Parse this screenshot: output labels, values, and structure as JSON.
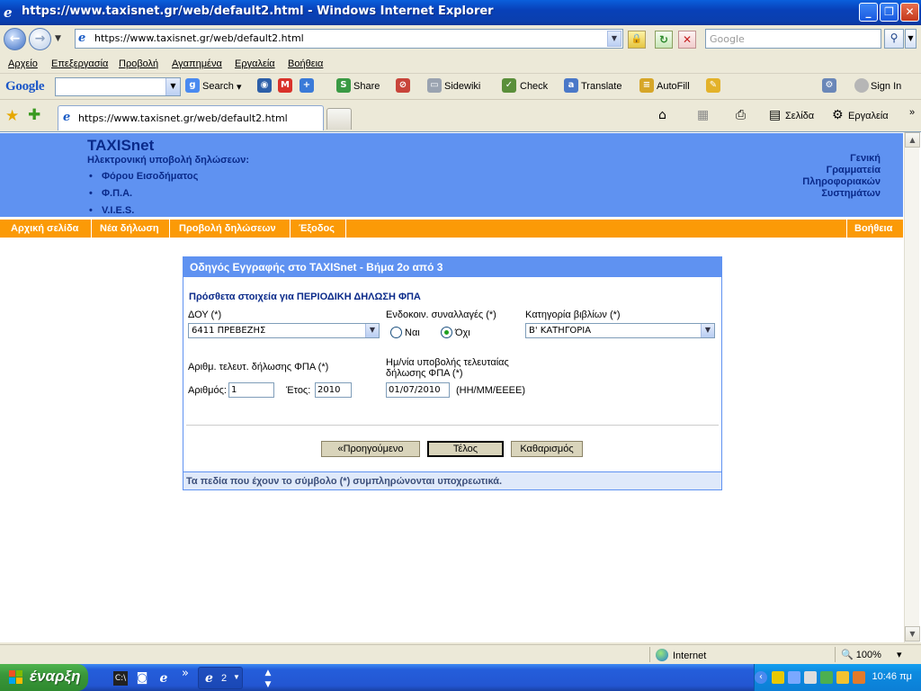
{
  "window": {
    "title": "https://www.taxisnet.gr/web/default2.html - Windows Internet Explorer",
    "minimize": "_",
    "maximize": "❐",
    "close": "✕"
  },
  "address_bar": {
    "url": "https://www.taxisnet.gr/web/default2.html",
    "search_placeholder": "Google"
  },
  "menu": {
    "items": [
      "Αρχείο",
      "Επεξεργασία",
      "Προβολή",
      "Αγαπημένα",
      "Εργαλεία",
      "Βοήθεια"
    ]
  },
  "google_toolbar": {
    "logo": "Google",
    "search_label": "Search",
    "share_label": "Share",
    "sidewiki_label": "Sidewiki",
    "check_label": "Check",
    "translate_label": "Translate",
    "autofill_label": "AutoFill",
    "signin_label": "Sign In"
  },
  "tabs": {
    "active_tab_title": "https://www.taxisnet.gr/web/default2.html"
  },
  "command_bar": {
    "page_label": "Σελίδα",
    "tools_label": "Εργαλεία",
    "more": "»"
  },
  "banner": {
    "brand": "TAXISnet",
    "subtitle": "Ηλεκτρονική υποβολή δηλώσεων:",
    "bullets": [
      "Φόρου Εισοδήματος",
      "Φ.Π.Α.",
      "V.I.E.S."
    ],
    "right_lines": [
      "Γενική",
      "Γραμματεία",
      "Πληροφοριακών",
      "Συστημάτων"
    ]
  },
  "nav": {
    "home": "Αρχική σελίδα",
    "new_declaration": "Νέα δήλωση",
    "view_declarations": "Προβολή δηλώσεων",
    "exit": "Έξοδος",
    "help": "Βοήθεια"
  },
  "wizard": {
    "title": "Οδηγός Εγγραφής στο TAXISnet - Βήμα 2ο από 3",
    "section_title": "Πρόσθετα στοιχεία για ΠΕΡΙΟΔΙΚΗ ΔΗΛΩΣΗ ΦΠΑ",
    "doy_label": "ΔΟΥ (*)",
    "doy_value": "6411 ΠΡΕΒΕΖΗΣ",
    "intra_label": "Ενδοκοιν. συναλλαγές (*)",
    "yes_label": "Ναι",
    "no_label": "Όχι",
    "intra_selected": "Όχι",
    "books_label": "Κατηγορία βιβλίων (*)",
    "books_value": "Β' ΚΑΤΗΓΟΡΙΑ",
    "last_decl_label": "Αριθμ. τελευτ. δήλωσης ΦΠΑ (*)",
    "number_label": "Αριθμός:",
    "number_value": "1",
    "year_label": "Έτος:",
    "year_value": "2010",
    "date_label_line1": "Ημ/νία υποβολής τελευταίας",
    "date_label_line2": "δήλωσης ΦΠΑ (*)",
    "date_value": "01/07/2010",
    "date_format": "(ΗΗ/ΜΜ/ΕΕΕΕ)",
    "prev_button": "«Προηγούμενο",
    "finish_button": "Τέλος",
    "clear_button": "Καθαρισμός",
    "footer_note": "Τα πεδία που έχουν το σύμβολο (*) συμπληρώνονται υποχρεωτικά."
  },
  "status_bar": {
    "zone": "Internet",
    "zoom": "100%"
  },
  "taskbar": {
    "start_label": "έναρξη",
    "task_count": "2",
    "clock": "10:46 πμ"
  }
}
